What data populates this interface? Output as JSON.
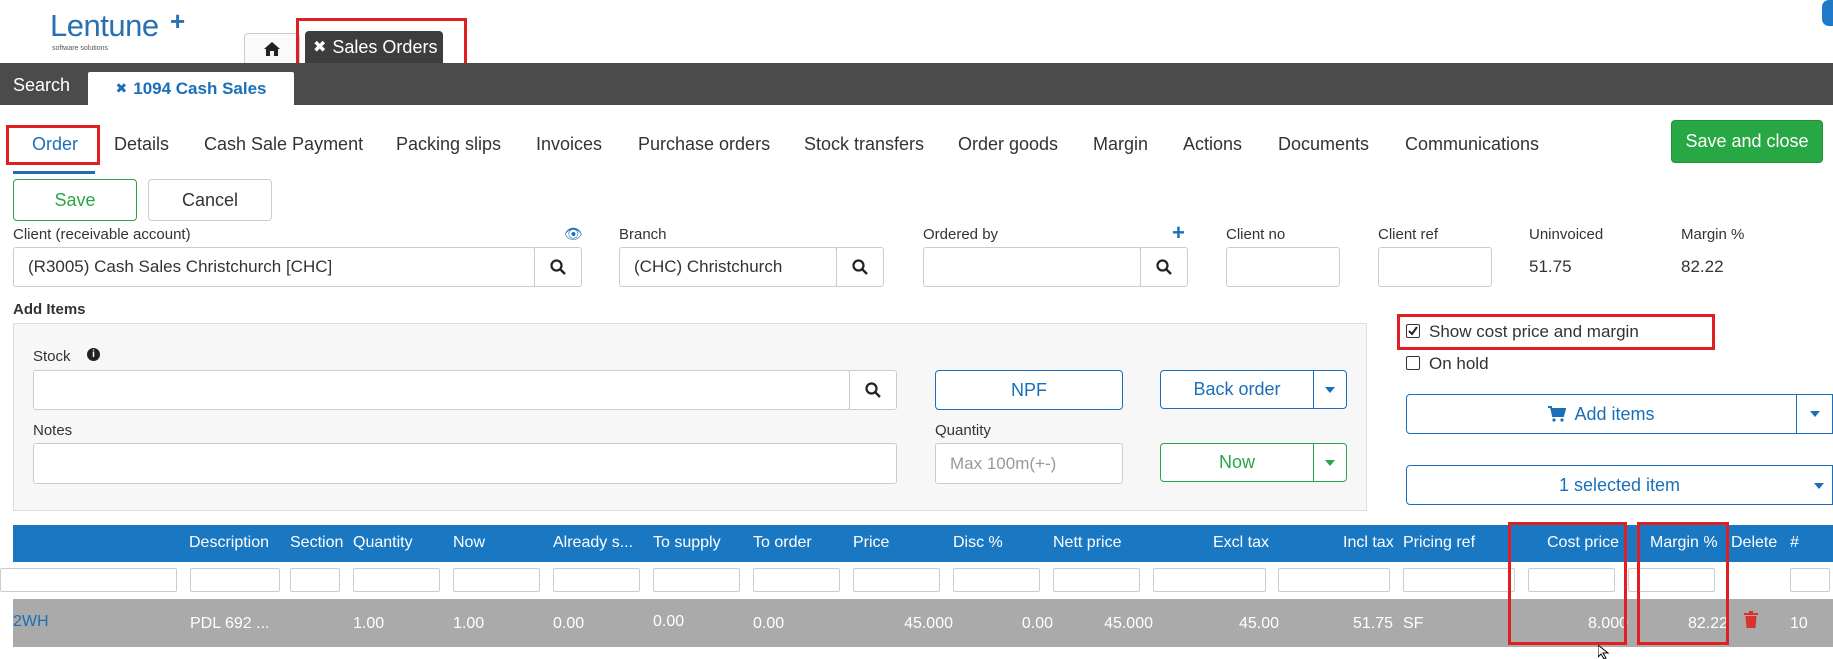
{
  "app": {
    "logo_text": "Lentune",
    "logo_sub": "software solutions",
    "tab_sales_orders": "Sales Orders"
  },
  "nav": {
    "search_tab": "Search",
    "doc_tab": "1094 Cash Sales"
  },
  "subtabs": [
    "Order",
    "Details",
    "Cash Sale Payment",
    "Packing slips",
    "Invoices",
    "Purchase orders",
    "Stock transfers",
    "Order goods",
    "Margin",
    "Actions",
    "Documents",
    "Communications"
  ],
  "buttons": {
    "save_close": "Save and close",
    "save": "Save",
    "cancel": "Cancel",
    "npf": "NPF",
    "back_order": "Back order",
    "now": "Now",
    "add_items": "Add items",
    "selected_item": "1 selected item"
  },
  "header": {
    "client_label": "Client (receivable account)",
    "client_value": "(R3005) Cash Sales Christchurch [CHC]",
    "branch_label": "Branch",
    "branch_value": "(CHC) Christchurch",
    "ordered_by_label": "Ordered by",
    "client_no_label": "Client no",
    "client_ref_label": "Client ref",
    "uninvoiced_label": "Uninvoiced",
    "uninvoiced_value": "51.75",
    "margin_label": "Margin %",
    "margin_value": "82.22"
  },
  "add_items": {
    "section_label": "Add Items",
    "stock_label": "Stock",
    "notes_label": "Notes",
    "quantity_label": "Quantity",
    "quantity_placeholder": "Max 100m(+-)"
  },
  "options": {
    "show_cost_label": "Show cost price and margin",
    "show_cost_checked": true,
    "on_hold_label": "On hold",
    "on_hold_checked": false
  },
  "table": {
    "columns": [
      "Description",
      "Section",
      "Quantity",
      "Now",
      "Already s...",
      "To supply",
      "To order",
      "Price",
      "Disc %",
      "Nett price",
      "Excl tax",
      "Incl tax",
      "Pricing ref",
      "Cost price",
      "Margin %",
      "Delete",
      "#"
    ],
    "rows": [
      {
        "code": "2WH",
        "description": "PDL 692 ...",
        "section": "",
        "quantity": "1.00",
        "now": "1.00",
        "already": "0.00",
        "to_supply": "0.00",
        "to_order": "0.00",
        "price": "45.000",
        "disc": "0.00",
        "nett": "45.000",
        "excl": "45.00",
        "incl": "51.75",
        "pricing_ref": "SF",
        "cost": "8.000",
        "margin": "82.22",
        "num": "10"
      }
    ]
  },
  "colors": {
    "brand_blue": "#1a78c2",
    "green": "#28a745",
    "highlight_red": "#e02020"
  }
}
